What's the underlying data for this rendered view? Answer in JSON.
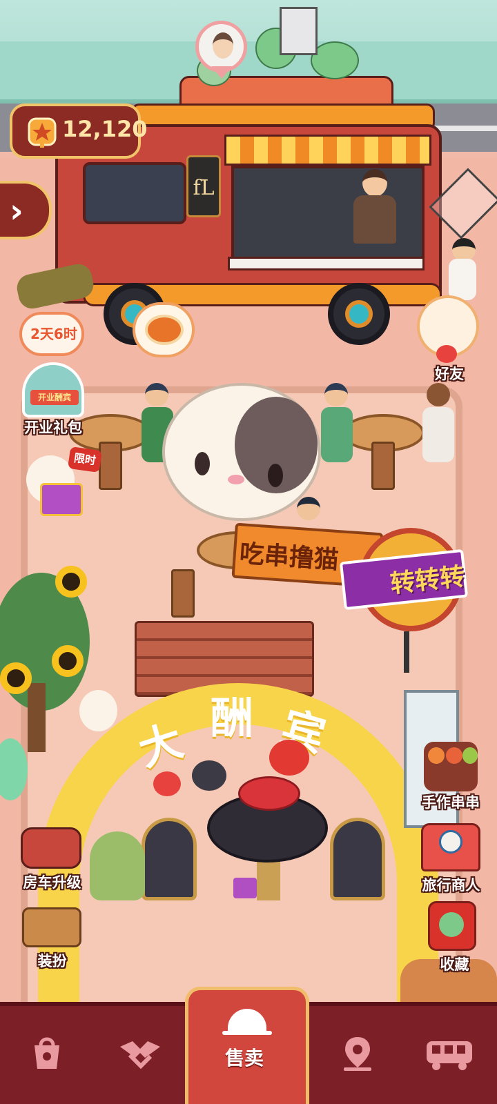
{
  "hud": {
    "coins": "12,120"
  },
  "truck": {
    "sign_text": "fL"
  },
  "timer": {
    "text": "2天6时"
  },
  "left_menu": {
    "opening_gift_label": "开业礼包",
    "opening_gift_banner": "开业酬宾",
    "limited_badge": "限时",
    "rv_upgrade_label": "房车升级",
    "dress_up_label": "装扮"
  },
  "right_menu": {
    "friends_label": "好友",
    "handmade_skewers_label": "手作串串",
    "traveling_merchant_label": "旅行商人",
    "collection_label": "收藏"
  },
  "scene": {
    "flag_text": "吃串撸猫",
    "wheel_text": "转转转",
    "arch_chars": [
      "大",
      "酬",
      "宾"
    ]
  },
  "nav": {
    "sell_label": "售卖"
  },
  "colors": {
    "accent": "#8c2a24",
    "nav": "#7d1f26",
    "gold": "#f2c46a"
  }
}
